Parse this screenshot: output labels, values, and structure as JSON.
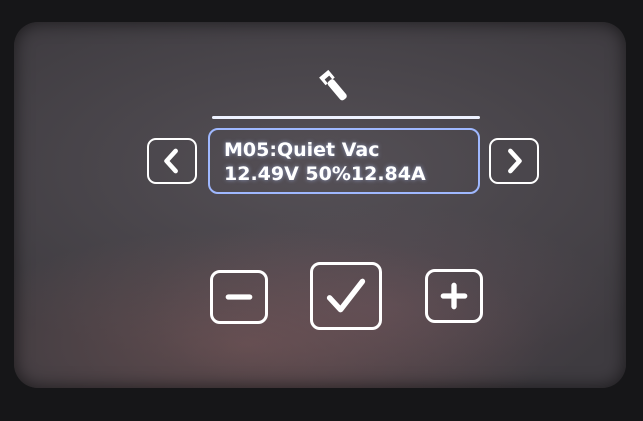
{
  "header": {
    "icon": "wrench-icon"
  },
  "display": {
    "line1": "M05:Quiet Vac",
    "line2": "12.49V 50%12.84A"
  },
  "nav": {
    "prev_icon": "chevron-left-icon",
    "next_icon": "chevron-right-icon"
  },
  "controls": {
    "decrease_icon": "minus-icon",
    "confirm_icon": "checkmark-icon",
    "increase_icon": "plus-icon"
  },
  "colors": {
    "foreground": "#ffffff",
    "display_border": "#9fb8ff",
    "panel": "#47444a"
  }
}
